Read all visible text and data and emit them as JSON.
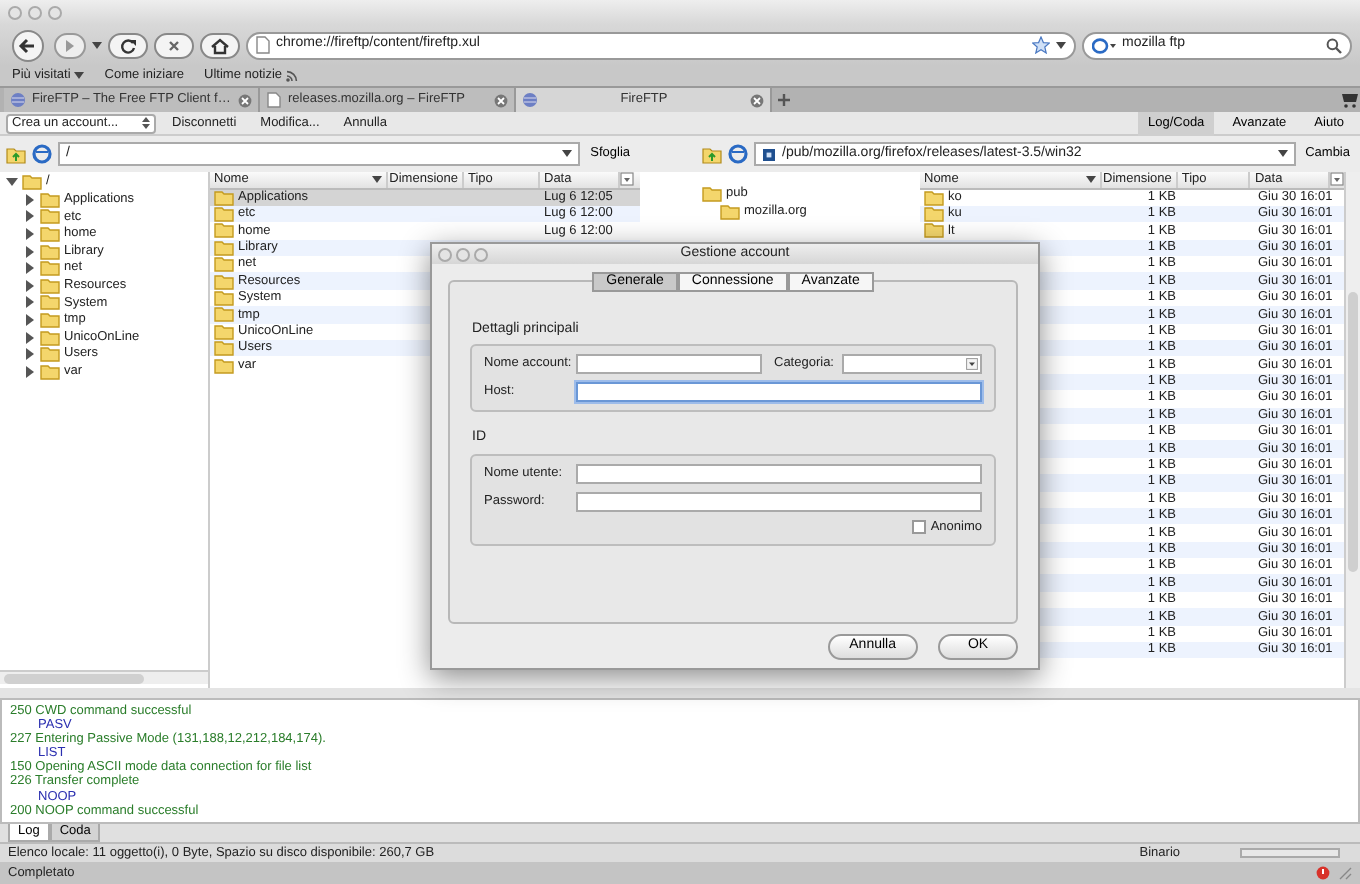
{
  "navigation": {
    "url": "chrome://fireftp/content/fireftp.xul",
    "search": "mozilla ftp"
  },
  "bookmarks": [
    {
      "label": "Più visitati",
      "kind": "menu"
    },
    {
      "label": "Come iniziare",
      "kind": "link"
    },
    {
      "label": "Ultime notizie",
      "kind": "feed"
    }
  ],
  "tabs": [
    {
      "label": "FireFTP – The Free FTP Client f…",
      "selected": false
    },
    {
      "label": "releases.mozilla.org – FireFTP",
      "selected": false
    },
    {
      "label": "FireFTP",
      "selected": true
    }
  ],
  "toolbar": {
    "account_select": "Crea un account...",
    "buttons": [
      "Disconnetti",
      "Modifica...",
      "Annulla"
    ],
    "right_tabs": [
      {
        "label": "Log/Coda",
        "selected": true
      },
      {
        "label": "Avanzate",
        "selected": false
      },
      {
        "label": "Aiuto",
        "selected": false
      }
    ]
  },
  "local": {
    "path": "/",
    "button": "Sfoglia",
    "tree": [
      {
        "label": "/",
        "expanded": true,
        "children": [
          {
            "label": "Applications",
            "expanded": false
          },
          {
            "label": "etc",
            "expanded": false
          },
          {
            "label": "home",
            "expanded": false
          },
          {
            "label": "Library",
            "expanded": false
          },
          {
            "label": "net",
            "expanded": false
          },
          {
            "label": "Resources",
            "expanded": false
          },
          {
            "label": "System",
            "expanded": false
          },
          {
            "label": "tmp",
            "expanded": false
          },
          {
            "label": "UnicoOnLine",
            "expanded": false
          },
          {
            "label": "Users",
            "expanded": false
          },
          {
            "label": "var",
            "expanded": false
          }
        ]
      }
    ],
    "columns": [
      "Nome",
      "Dimensione",
      "Tipo",
      "Data"
    ],
    "rows": [
      {
        "name": "Applications",
        "date": "Lug 6 12:05",
        "selected": true
      },
      {
        "name": "etc",
        "date": "Lug 6 12:00",
        "selected": false
      },
      {
        "name": "home",
        "date": "Lug 6 12:00",
        "selected": false
      },
      {
        "name": "Library",
        "selected": false
      },
      {
        "name": "net",
        "selected": false
      },
      {
        "name": "Resources",
        "selected": false
      },
      {
        "name": "System",
        "selected": false
      },
      {
        "name": "tmp",
        "selected": false
      },
      {
        "name": "UnicoOnLine",
        "selected": false
      },
      {
        "name": "Users",
        "selected": false
      },
      {
        "name": "var",
        "selected": false
      }
    ]
  },
  "remote": {
    "path": "/pub/mozilla.org/firefox/releases/latest-3.5/win32",
    "button": "Cambia",
    "tree": [
      {
        "label": "pub",
        "children": [
          {
            "label": "mozilla.org"
          }
        ]
      }
    ],
    "columns": [
      "Nome",
      "Dimensione",
      "Tipo",
      "Data"
    ],
    "rows": [
      {
        "name": "ko",
        "size": "1 KB",
        "date": "Giu 30 16:01"
      },
      {
        "name": "ku",
        "size": "1 KB",
        "date": "Giu 30 16:01"
      },
      {
        "name": "lt",
        "size": "1 KB",
        "date": "Giu 30 16:01"
      },
      {
        "size": "1 KB",
        "date": "Giu 30 16:01"
      },
      {
        "size": "1 KB",
        "date": "Giu 30 16:01"
      },
      {
        "size": "1 KB",
        "date": "Giu 30 16:01"
      },
      {
        "size": "1 KB",
        "date": "Giu 30 16:01"
      },
      {
        "size": "1 KB",
        "date": "Giu 30 16:01"
      },
      {
        "size": "1 KB",
        "date": "Giu 30 16:01"
      },
      {
        "size": "1 KB",
        "date": "Giu 30 16:01"
      },
      {
        "size": "1 KB",
        "date": "Giu 30 16:01"
      },
      {
        "size": "1 KB",
        "date": "Giu 30 16:01"
      },
      {
        "size": "1 KB",
        "date": "Giu 30 16:01"
      },
      {
        "size": "1 KB",
        "date": "Giu 30 16:01"
      },
      {
        "size": "1 KB",
        "date": "Giu 30 16:01"
      },
      {
        "size": "1 KB",
        "date": "Giu 30 16:01"
      },
      {
        "size": "1 KB",
        "date": "Giu 30 16:01"
      },
      {
        "size": "1 KB",
        "date": "Giu 30 16:01"
      },
      {
        "size": "1 KB",
        "date": "Giu 30 16:01"
      },
      {
        "size": "1 KB",
        "date": "Giu 30 16:01"
      },
      {
        "size": "1 KB",
        "date": "Giu 30 16:01"
      },
      {
        "size": "1 KB",
        "date": "Giu 30 16:01"
      },
      {
        "size": "1 KB",
        "date": "Giu 30 16:01"
      },
      {
        "size": "1 KB",
        "date": "Giu 30 16:01"
      },
      {
        "size": "1 KB",
        "date": "Giu 30 16:01"
      },
      {
        "size": "1 KB",
        "date": "Giu 30 16:01"
      },
      {
        "size": "1 KB",
        "date": "Giu 30 16:01"
      },
      {
        "size": "1 KB",
        "date": "Giu 30 16:01"
      }
    ]
  },
  "log": [
    {
      "text": "250 CWD command successful",
      "kind": "response"
    },
    {
      "text": "PASV",
      "kind": "command"
    },
    {
      "text": "227 Entering Passive Mode (131,188,12,212,184,174).",
      "kind": "response"
    },
    {
      "text": "LIST",
      "kind": "command"
    },
    {
      "text": "150 Opening ASCII mode data connection for file list",
      "kind": "response"
    },
    {
      "text": "226 Transfer complete",
      "kind": "response"
    },
    {
      "text": "NOOP",
      "kind": "command"
    },
    {
      "text": "200 NOOP command successful",
      "kind": "response"
    }
  ],
  "log_tabs": [
    {
      "label": "Log",
      "selected": true
    },
    {
      "label": "Coda",
      "selected": false
    }
  ],
  "status": {
    "text": "Elenco locale: 11 oggetto(i), 0 Byte, Spazio su disco disponibile: 260,7 GB",
    "mode": "Binario",
    "progress": {
      "level": 0
    }
  },
  "browser_status": "Completato",
  "dialog": {
    "title": "Gestione account",
    "tabs": [
      {
        "label": "Generale",
        "selected": true
      },
      {
        "label": "Connessione",
        "selected": false
      },
      {
        "label": "Avanzate",
        "selected": false
      }
    ],
    "sections": [
      {
        "title": "Dettagli principali",
        "rows": [
          [
            {
              "label": "Nome account:",
              "kind": "text",
              "focused": false
            },
            {
              "label": "Categoria:",
              "kind": "select"
            }
          ],
          [
            {
              "label": "Host:",
              "kind": "text",
              "focused": true
            }
          ]
        ]
      },
      {
        "title": "ID",
        "rows": [
          [
            {
              "label": "Nome utente:",
              "kind": "text",
              "focused": false
            }
          ],
          [
            {
              "label": "Password:",
              "kind": "password",
              "focused": false
            }
          ],
          [
            {
              "label": "Anonimo",
              "kind": "checkbox",
              "checked": false
            }
          ]
        ]
      }
    ],
    "buttons": [
      "Annulla",
      "OK"
    ]
  }
}
